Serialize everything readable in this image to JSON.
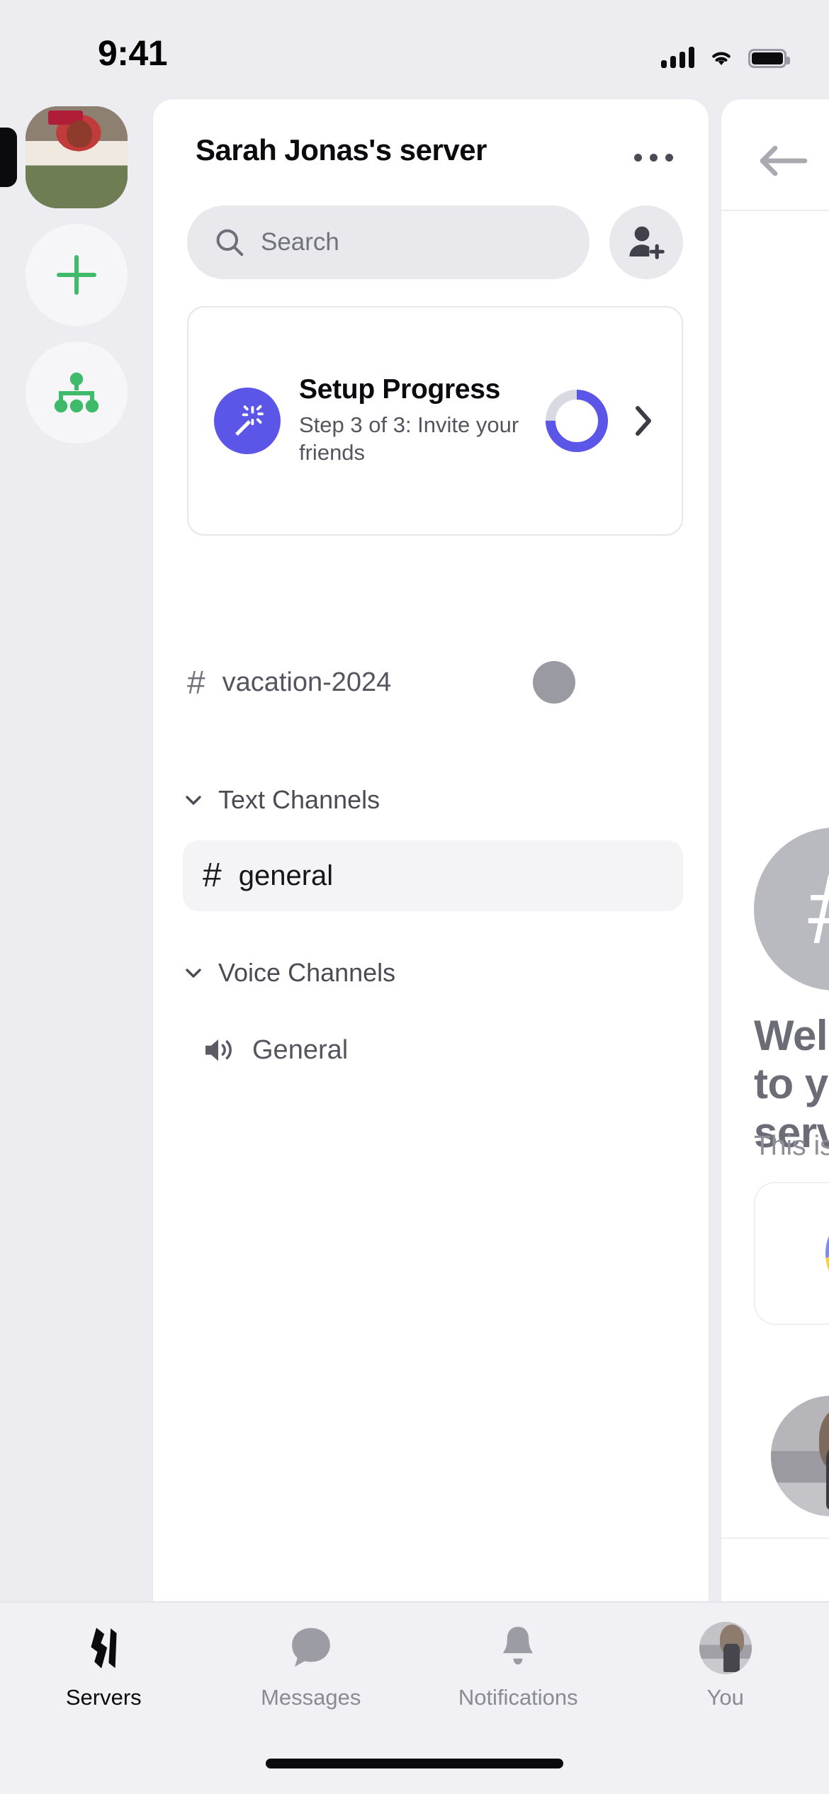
{
  "status_bar": {
    "time": "9:41",
    "icons": [
      "cellular-signal-icon",
      "wifi-icon",
      "battery-icon"
    ],
    "battery_full": true
  },
  "colors": {
    "page_background": "#ededf1",
    "panel_background": "#ffffff",
    "accent_purple": "#5b55e8",
    "accent_green": "#3fba6a",
    "progress_track": "#d9d9e2",
    "muted_text": "#72727c",
    "active_tab": "#0b0b0f",
    "search_field": "#e8e8ed"
  },
  "server_rail": {
    "items": [
      {
        "name": "server-avatar",
        "type": "avatar",
        "active": true,
        "label": ""
      },
      {
        "name": "add-server-button",
        "type": "icon",
        "icon": "plus-icon",
        "active": false,
        "label": ""
      },
      {
        "name": "discover-servers-button",
        "type": "icon",
        "icon": "hierarchy-icon",
        "active": false,
        "label": ""
      }
    ]
  },
  "server_panel": {
    "title": "Sarah Jonas's server",
    "more_icon": "ellipsis-icon",
    "search": {
      "placeholder": "Search",
      "value": "",
      "icon": "search-icon"
    },
    "invite_button": {
      "icon": "person-add-icon",
      "label": ""
    },
    "setup_card": {
      "icon": "magic-wand-icon",
      "title": "Setup Progress",
      "subtitle": "Step 3 of 3: Invite your friends",
      "progress_percent": 75,
      "step_current": 3,
      "step_total": 3,
      "chevron_icon": "chevron-right-icon"
    },
    "loose_channel": {
      "icon": "hash-icon",
      "name": "vacation-2024"
    },
    "sections": [
      {
        "name": "Text Channels",
        "chevron_icon": "chevron-down-icon",
        "channels": [
          {
            "icon": "hash-icon",
            "name": "general",
            "selected": true
          }
        ]
      },
      {
        "name": "Voice Channels",
        "chevron_icon": "chevron-down-icon",
        "channels": [
          {
            "icon": "speaker-icon",
            "name": "General",
            "selected": false
          }
        ]
      }
    ]
  },
  "channel_peek_panel": {
    "back_icon": "arrow-left-icon",
    "avatar_glyph": "#",
    "heading": "Welcome to your server",
    "subtitle": "This is the",
    "card_icon": "globe-emoji-icon",
    "member_avatar": "member-avatar"
  },
  "tab_bar": {
    "tabs": [
      {
        "label": "Servers",
        "icon": "servers-icon",
        "active": true
      },
      {
        "label": "Messages",
        "icon": "chat-bubble-icon",
        "active": false
      },
      {
        "label": "Notifications",
        "icon": "bell-icon",
        "active": false
      },
      {
        "label": "You",
        "icon": "user-avatar-icon",
        "active": false
      }
    ],
    "home_indicator": true
  }
}
